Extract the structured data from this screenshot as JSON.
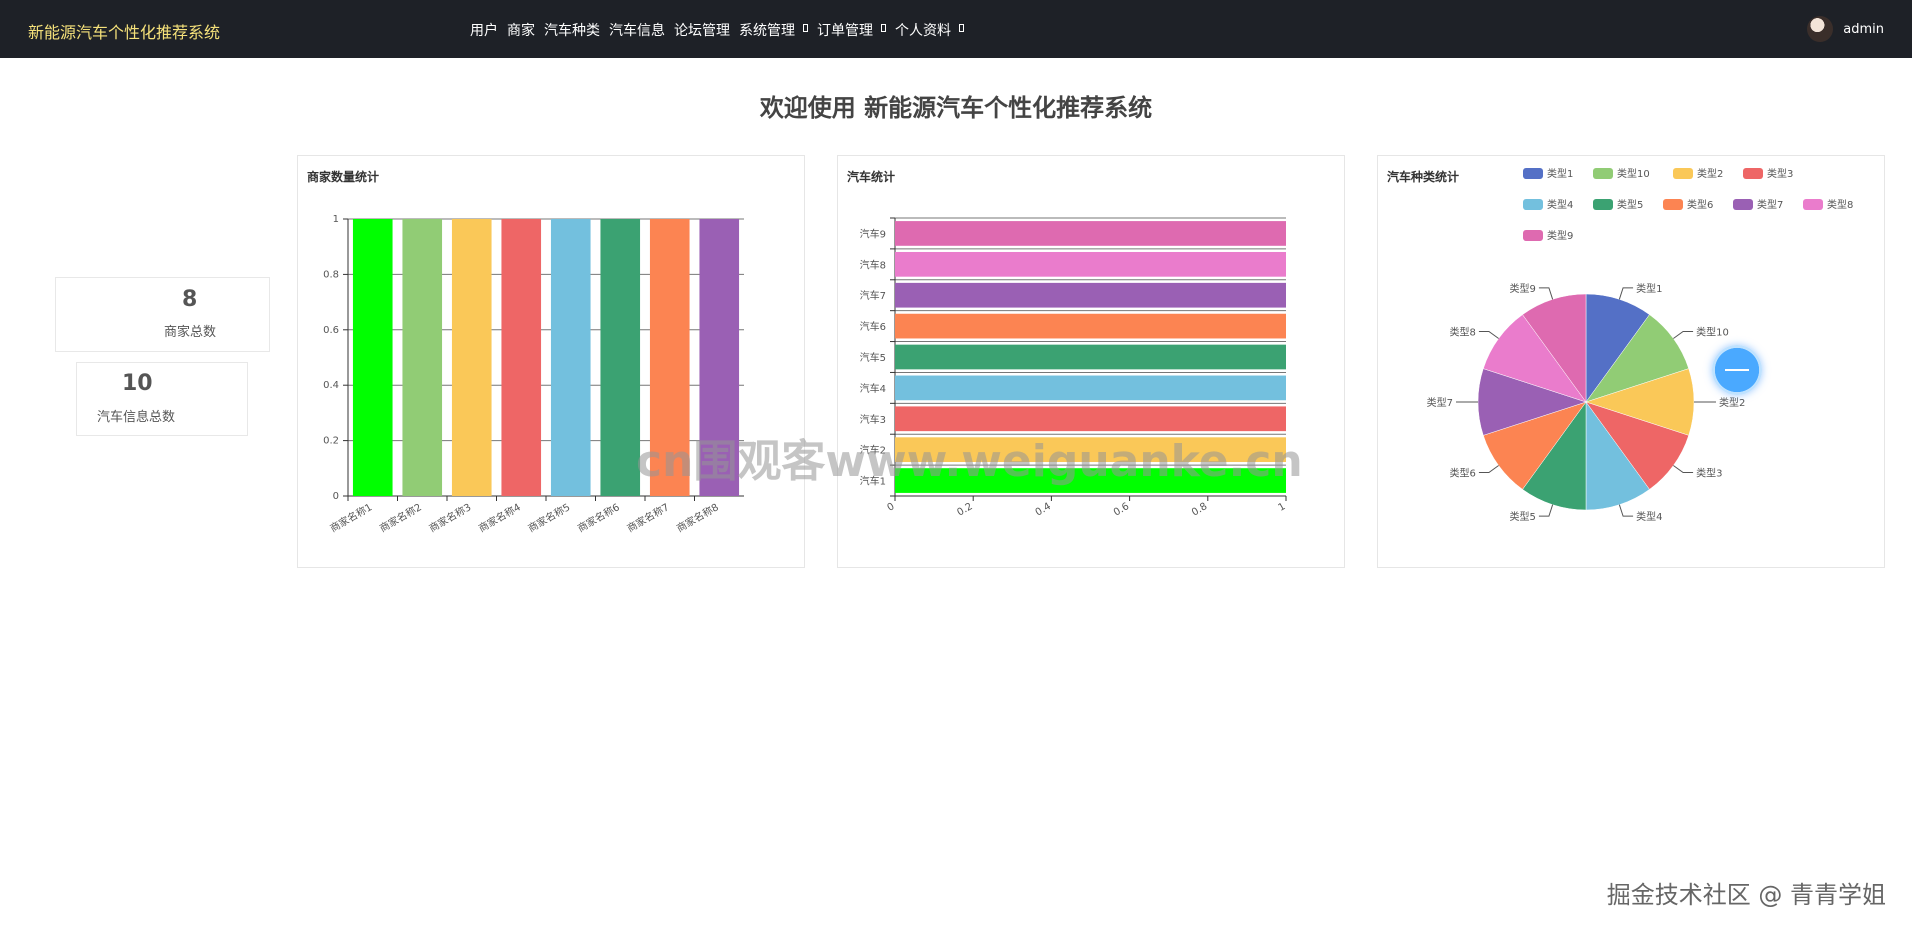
{
  "header": {
    "brand": "新能源汽车个性化推荐系统",
    "nav": [
      {
        "label": "用户",
        "dropdown": false
      },
      {
        "label": "商家",
        "dropdown": false
      },
      {
        "label": "汽车种类",
        "dropdown": false
      },
      {
        "label": "汽车信息",
        "dropdown": false
      },
      {
        "label": "论坛管理",
        "dropdown": false
      },
      {
        "label": "系统管理",
        "dropdown": true
      },
      {
        "label": "订单管理",
        "dropdown": true
      },
      {
        "label": "个人资料",
        "dropdown": true
      }
    ],
    "username": "admin"
  },
  "main": {
    "title": "欢迎使用 新能源汽车个性化推荐系统"
  },
  "stats": [
    {
      "value": "8",
      "label": "商家总数"
    },
    {
      "value": "10",
      "label": "汽车信息总数"
    }
  ],
  "watermarks": {
    "center": "cn围观客www.weiguanke.cn",
    "corner": "掘金技术社区 @ 青青学姐"
  },
  "chart_data": [
    {
      "type": "bar",
      "title": "商家数量统计",
      "categories": [
        "商家名称1",
        "商家名称2",
        "商家名称3",
        "商家名称4",
        "商家名称5",
        "商家名称6",
        "商家名称7",
        "商家名称8"
      ],
      "values": [
        1,
        1,
        1,
        1,
        1,
        1,
        1,
        1
      ],
      "colors": [
        "#00ff00",
        "#91cc75",
        "#fac858",
        "#ee6666",
        "#73c0de",
        "#3ba272",
        "#fc8452",
        "#9a60b4"
      ],
      "yticks": [
        "0",
        "0.2",
        "0.4",
        "0.6",
        "0.8",
        "1"
      ],
      "ylim": [
        0,
        1
      ]
    },
    {
      "type": "bar",
      "orientation": "horizontal",
      "title": "汽车统计",
      "categories": [
        "汽车1",
        "汽车2",
        "汽车3",
        "汽车4",
        "汽车5",
        "汽车6",
        "汽车7",
        "汽车8",
        "汽车9"
      ],
      "values": [
        1,
        1,
        1,
        1,
        1,
        1,
        1,
        1,
        1
      ],
      "colors": [
        "#00ff00",
        "#fac858",
        "#ee6666",
        "#73c0de",
        "#3ba272",
        "#fc8452",
        "#9a60b4",
        "#ea7ccc",
        "#de6ab0"
      ],
      "xticks": [
        "0",
        "0.2",
        "0.4",
        "0.6",
        "0.8",
        "1"
      ],
      "xlim": [
        0,
        1
      ]
    },
    {
      "type": "pie",
      "title": "汽车种类统计",
      "legend_position": "top-right",
      "slices": [
        {
          "name": "类型1",
          "value": 1,
          "color": "#5470c6"
        },
        {
          "name": "类型10",
          "value": 1,
          "color": "#91cc75"
        },
        {
          "name": "类型2",
          "value": 1,
          "color": "#fac858"
        },
        {
          "name": "类型3",
          "value": 1,
          "color": "#ee6666"
        },
        {
          "name": "类型4",
          "value": 1,
          "color": "#73c0de"
        },
        {
          "name": "类型5",
          "value": 1,
          "color": "#3ba272"
        },
        {
          "name": "类型6",
          "value": 1,
          "color": "#fc8452"
        },
        {
          "name": "类型7",
          "value": 1,
          "color": "#9a60b4"
        },
        {
          "name": "类型8",
          "value": 1,
          "color": "#ea7ccc"
        },
        {
          "name": "类型9",
          "value": 1,
          "color": "#de6ab0"
        }
      ]
    }
  ]
}
